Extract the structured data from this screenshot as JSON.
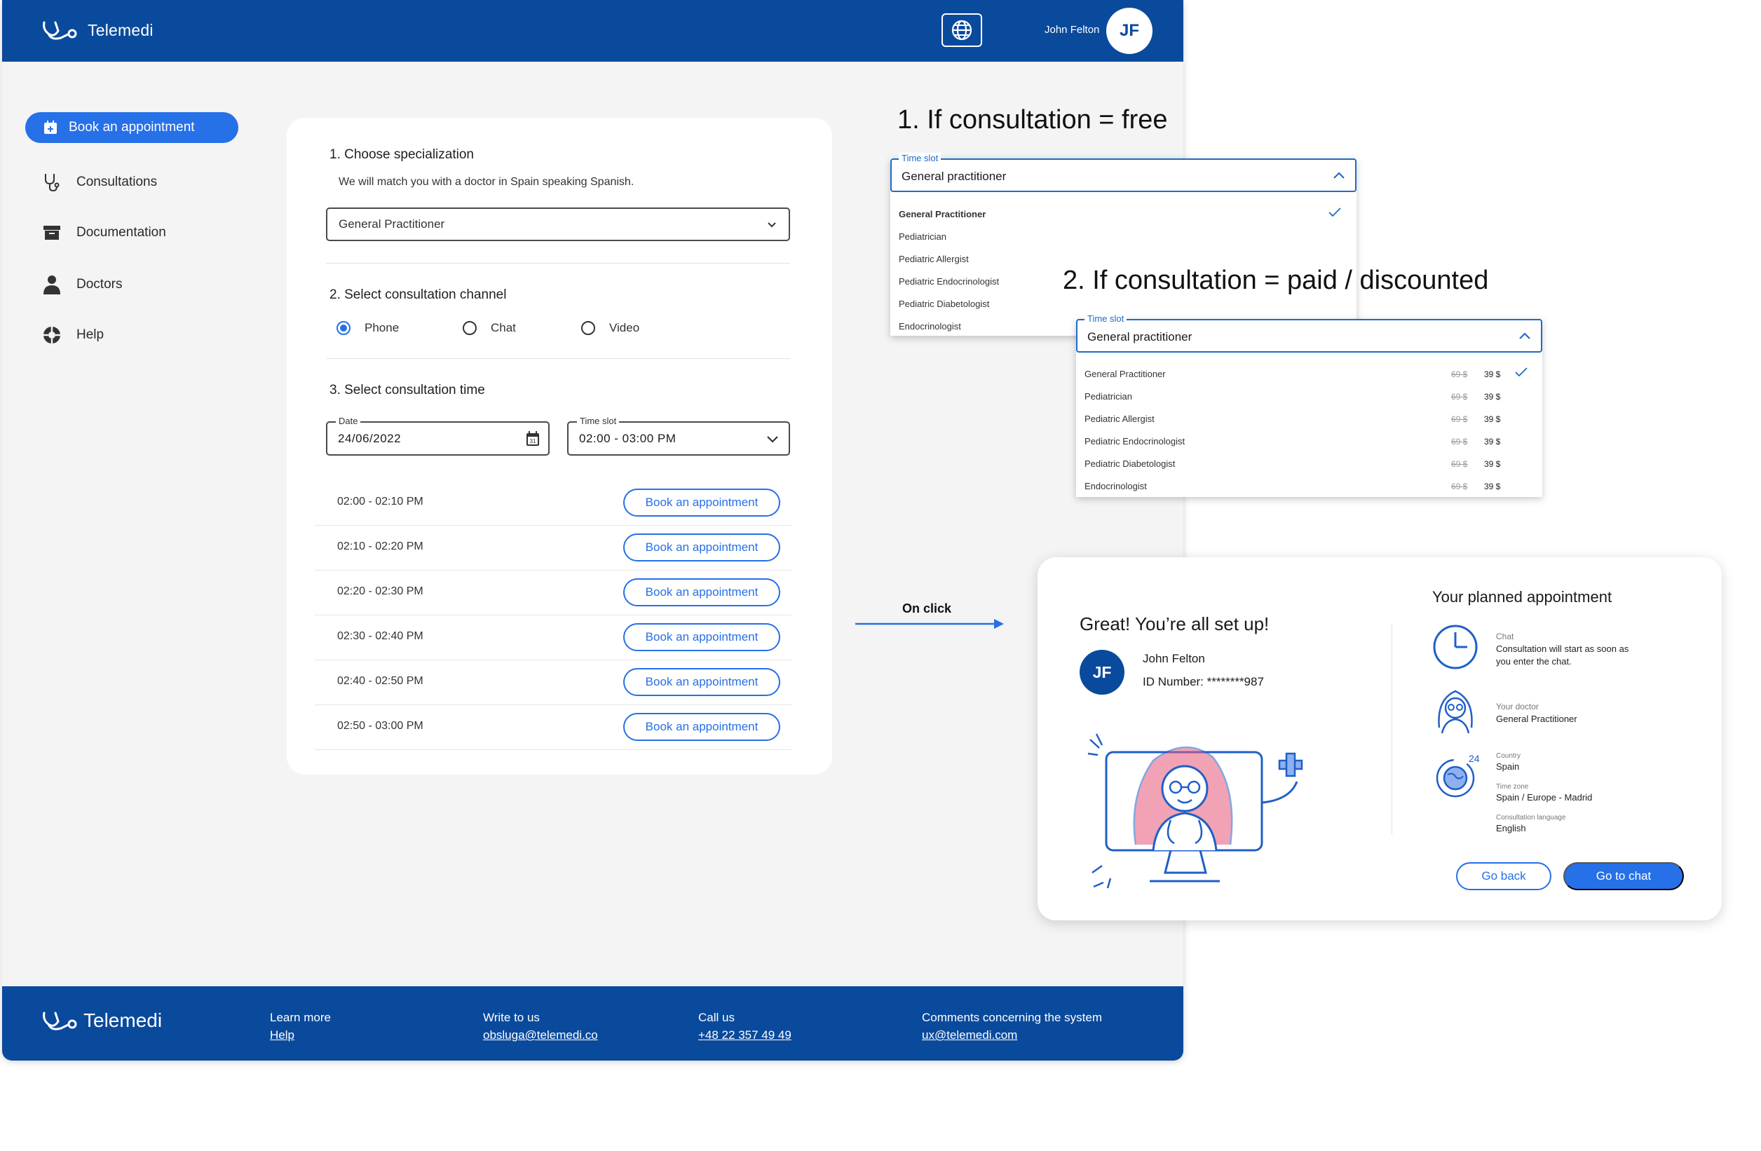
{
  "header": {
    "brand": "Telemedi",
    "user_name": "John Felton",
    "user_initials": "JF"
  },
  "sidebar": {
    "items": [
      {
        "label": "Book an appointment",
        "icon": "calendar-add-icon",
        "active": true
      },
      {
        "label": "Consultations",
        "icon": "stethoscope-icon"
      },
      {
        "label": "Documentation",
        "icon": "archive-box-icon"
      },
      {
        "label": "Doctors",
        "icon": "person-icon"
      },
      {
        "label": "Help",
        "icon": "lifebuoy-icon"
      }
    ]
  },
  "booking": {
    "section1_title": "1. Choose specialization",
    "section1_sub": "We will match you with a doctor in Spain speaking Spanish.",
    "specialization_value": "General Practitioner",
    "section2_title": "2. Select consultation channel",
    "channels": [
      {
        "label": "Phone",
        "checked": true
      },
      {
        "label": "Chat",
        "checked": false
      },
      {
        "label": "Video",
        "checked": false
      }
    ],
    "section3_title": "3. Select consultation time",
    "date_label": "Date",
    "date_value": "24/06/2022",
    "timeslot_label": "Time slot",
    "timeslot_value": "02:00 - 03:00 PM",
    "slots": [
      {
        "time": "02:00 - 02:10 PM",
        "button": "Book an appointment"
      },
      {
        "time": "02:10 - 02:20 PM",
        "button": "Book an appointment"
      },
      {
        "time": "02:20 - 02:30 PM",
        "button": "Book an appointment"
      },
      {
        "time": "02:30 - 02:40 PM",
        "button": "Book an appointment"
      },
      {
        "time": "02:40 - 02:50 PM",
        "button": "Book an appointment"
      },
      {
        "time": "02:50 - 03:00 PM",
        "button": "Book an appointment"
      }
    ]
  },
  "footer": {
    "brand": "Telemedi",
    "learn_more": "Learn more",
    "help": "Help",
    "write_to_us": "Write to us",
    "email": "obsluga@telemedi.co",
    "call_us": "Call us",
    "phone": "+48 22 357 49 49",
    "comments": "Comments concerning the system",
    "ux_email": "ux@telemedi.com"
  },
  "annotations": {
    "free_title": "1. If consultation = free",
    "paid_title": "2. If consultation = paid / discounted",
    "on_click": "On click"
  },
  "dropdown_free": {
    "label": "Time slot",
    "value": "General practitioner",
    "options": [
      "General Practitioner",
      "Pediatrician",
      "Pediatric Allergist",
      "Pediatric Endocrinologist",
      "Pediatric Diabetologist",
      "Endocrinologist"
    ]
  },
  "dropdown_paid": {
    "label": "Time slot",
    "value": "General practitioner",
    "options": [
      {
        "name": "General Practitioner",
        "old_price": "69 $",
        "price": "39 $"
      },
      {
        "name": "Pediatrician",
        "old_price": "69 $",
        "price": "39 $"
      },
      {
        "name": "Pediatric Allergist",
        "old_price": "69 $",
        "price": "39 $"
      },
      {
        "name": "Pediatric Endocrinologist",
        "old_price": "69 $",
        "price": "39 $"
      },
      {
        "name": "Pediatric Diabetologist",
        "old_price": "69 $",
        "price": "39 $"
      },
      {
        "name": "Endocrinologist",
        "old_price": "69 $",
        "price": "39 $"
      }
    ]
  },
  "confirmation": {
    "title": "Great! You’re all set up!",
    "initials": "JF",
    "name": "John Felton",
    "id_number": "ID Number: ********987",
    "planned_title": "Your planned appointment",
    "channel_label": "Chat",
    "channel_desc_line1": "Consultation will start as soon as",
    "channel_desc_line2": "you enter the chat.",
    "doctor_label": "Your doctor",
    "doctor_value": "General Practitioner",
    "country_label": "Country",
    "country_value": "Spain",
    "timezone_label": "Time zone",
    "timezone_value": "Spain / Europe - Madrid",
    "language_label": "Consultation language",
    "language_value": "English",
    "go_back": "Go back",
    "go_to_chat": "Go to chat"
  },
  "colors": {
    "primary_dark": "#0a4a9c",
    "primary": "#2670e8",
    "illustration_pink": "#e8577a"
  }
}
